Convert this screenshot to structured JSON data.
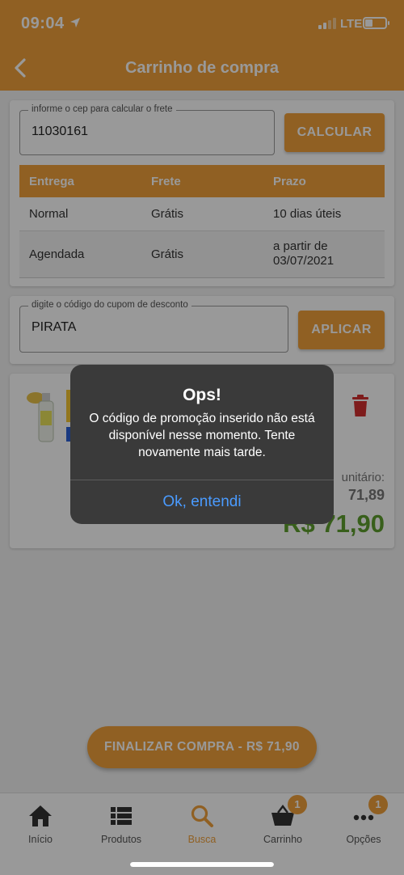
{
  "status_bar": {
    "time": "09:04",
    "network": "LTE"
  },
  "header": {
    "title": "Carrinho de compra"
  },
  "shipping": {
    "cep_label": "informe o cep para calcular o frete",
    "cep_value": "11030161",
    "calculate_label": "CALCULAR",
    "table": {
      "headers": [
        "Entrega",
        "Frete",
        "Prazo"
      ],
      "rows": [
        {
          "delivery": "Normal",
          "freight": "Grátis",
          "deadline": "10 dias úteis"
        },
        {
          "delivery": "Agendada",
          "freight": "Grátis",
          "deadline": "a partir de 03/07/2021"
        }
      ]
    }
  },
  "coupon": {
    "label": "digite o código do cupom de desconto",
    "value": "PIRATA",
    "apply_label": "APLICAR"
  },
  "product": {
    "unit_label": "unitário:",
    "unit_price": "71,89",
    "total_price": "R$ 71,90"
  },
  "checkout_label": "FINALIZAR COMPRA - R$ 71,90",
  "bottom_nav": [
    {
      "label": "Início",
      "icon": "home-icon"
    },
    {
      "label": "Produtos",
      "icon": "list-icon"
    },
    {
      "label": "Busca",
      "icon": "search-icon",
      "active": true
    },
    {
      "label": "Carrinho",
      "icon": "basket-icon",
      "badge": "1"
    },
    {
      "label": "Opções",
      "icon": "more-icon",
      "badge": "1"
    }
  ],
  "alert": {
    "title": "Ops!",
    "message": "O código de promoção inserido não está disponível nesse momento. Tente novamente mais tarde.",
    "ok_label": "Ok, entendi"
  },
  "colors": {
    "accent": "#f0a13b",
    "price_green": "#5e9f2e",
    "alert_link": "#4a9bff",
    "delete_red": "#d32f2f"
  }
}
